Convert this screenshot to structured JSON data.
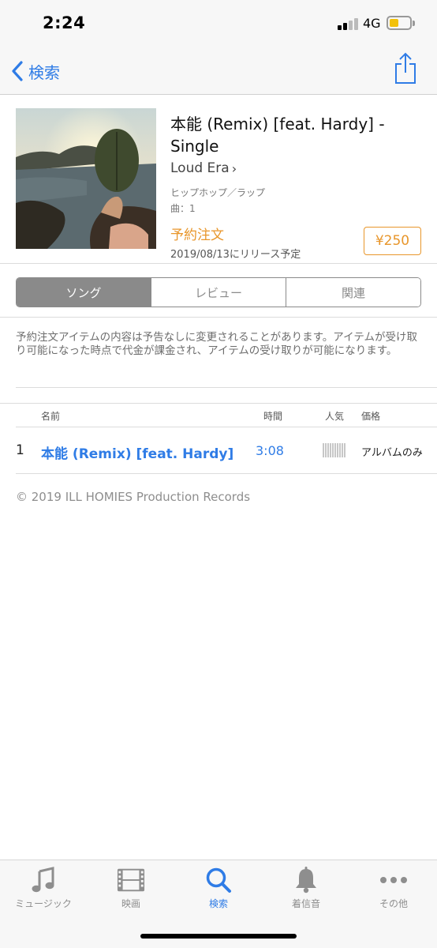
{
  "status_bar": {
    "time": "2:24",
    "network": "4G"
  },
  "nav": {
    "back_label": "検索"
  },
  "album": {
    "title": "本能 (Remix) [feat. Hardy] - Single",
    "artist": "Loud Era",
    "genre": "ヒップホップ／ラップ",
    "songs_count": "曲：1",
    "preorder_label": "予約注文",
    "price": "¥250",
    "release_date": "2019/08/13にリリース予定"
  },
  "segments": [
    {
      "label": "ソング",
      "active": true
    },
    {
      "label": "レビュー",
      "active": false
    },
    {
      "label": "関連",
      "active": false
    }
  ],
  "notice": "予約注文アイテムの内容は予告なしに変更されることがあります。アイテムが受け取り可能になった時点で代金が課金され、アイテムの受け取りが可能になります。",
  "track_list": {
    "headers": {
      "name": "名前",
      "time": "時間",
      "popularity": "人気",
      "price": "価格"
    },
    "tracks": [
      {
        "number": "1",
        "name": "本能 (Remix) [feat. Hardy]",
        "time": "3:08",
        "price": "アルバムのみ"
      }
    ]
  },
  "copyright": "© 2019 ILL HOMIES Production Records",
  "tab_bar": {
    "tabs": [
      {
        "label": "ミュージック",
        "icon": "music-note-icon"
      },
      {
        "label": "映画",
        "icon": "film-icon"
      },
      {
        "label": "検索",
        "icon": "search-icon",
        "active": true
      },
      {
        "label": "着信音",
        "icon": "bell-icon"
      },
      {
        "label": "その他",
        "icon": "more-icon"
      }
    ]
  },
  "colors": {
    "accent": "#2f7ce6",
    "preorder": "#e8962b",
    "segment_gray": "#8a8a8a",
    "battery": "#f2c10a"
  }
}
